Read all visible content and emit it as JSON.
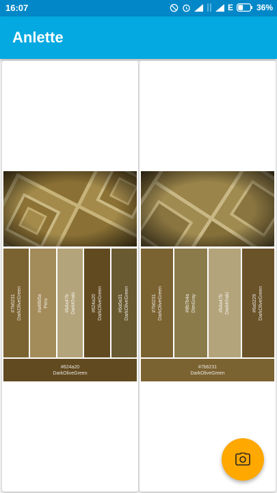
{
  "status": {
    "time": "16:07",
    "network": "E",
    "battery": "36%"
  },
  "app": {
    "title": "Anlette"
  },
  "cards": [
    {
      "swatches": [
        {
          "hex": "#7b6231",
          "name": "DarkOliveGreen",
          "color": "#7b6231"
        },
        {
          "hex": "#a48b5a",
          "name": "Peru",
          "color": "#a48b5a"
        },
        {
          "hex": "#b4a47b",
          "name": "DarkKhaki",
          "color": "#b4a47b"
        },
        {
          "hex": "#624a20",
          "name": "DarkOliveGreen",
          "color": "#624a20"
        },
        {
          "hex": "#6a5a31",
          "name": "DarkOliveGreen",
          "color": "#6a5a31"
        }
      ],
      "dominant": {
        "hex": "#624a20",
        "name": "DarkOliveGreen",
        "color": "#624a20"
      }
    },
    {
      "swatches": [
        {
          "hex": "#7b6231",
          "name": "DarkOliveGreen",
          "color": "#7b6231"
        },
        {
          "hex": "#8b7b4a",
          "name": "DimGray",
          "color": "#8b7b4a"
        },
        {
          "hex": "#b4a47b",
          "name": "DarkKhaki",
          "color": "#b4a47b"
        },
        {
          "hex": "#6a5229",
          "name": "DarkOliveGreen",
          "color": "#6a5229"
        }
      ],
      "dominant": {
        "hex": "#7b6231",
        "name": "DarkOliveGreen",
        "color": "#7b6231"
      }
    }
  ],
  "fab": {
    "icon": "camera-icon",
    "color": "#ffa800"
  }
}
